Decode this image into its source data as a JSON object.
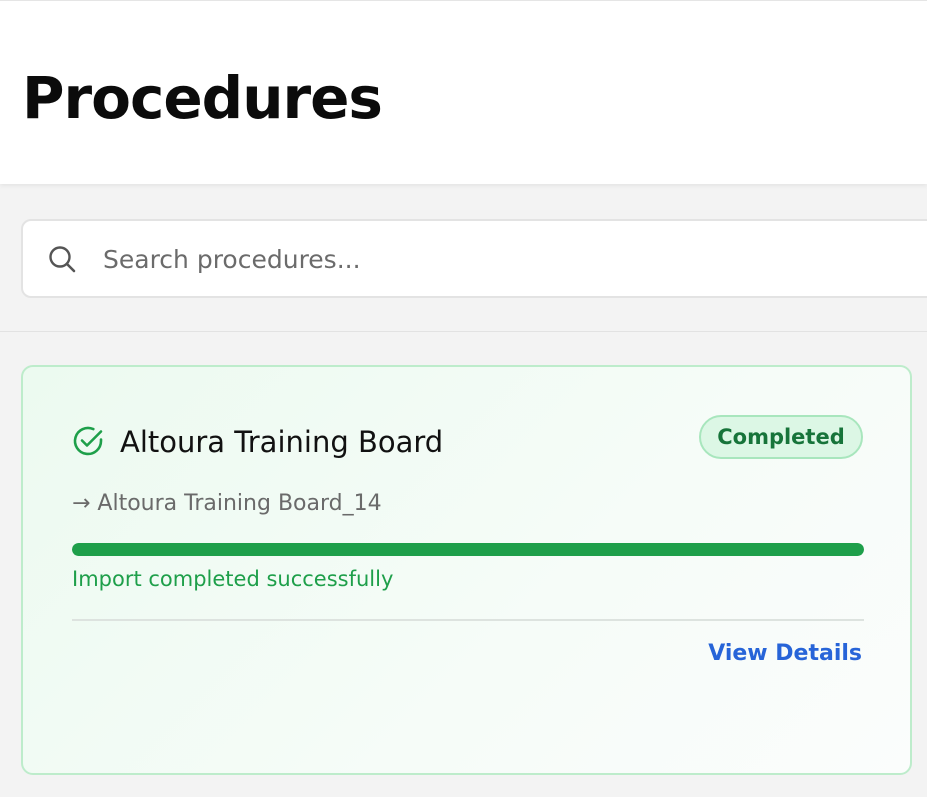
{
  "header": {
    "title": "Procedures"
  },
  "search": {
    "placeholder": "Search procedures..."
  },
  "procedure_card": {
    "title": "Altoura Training Board",
    "status": "Completed",
    "target": "→ Altoura Training Board_14",
    "progress": 1.0,
    "message": "Import completed successfully",
    "action_label": "View Details"
  },
  "colors": {
    "success": "#1e9f4a",
    "badge_bg": "#dcf7e5",
    "link": "#2764d8"
  },
  "icons": {
    "search": "search-icon",
    "status": "check-circle-icon"
  }
}
